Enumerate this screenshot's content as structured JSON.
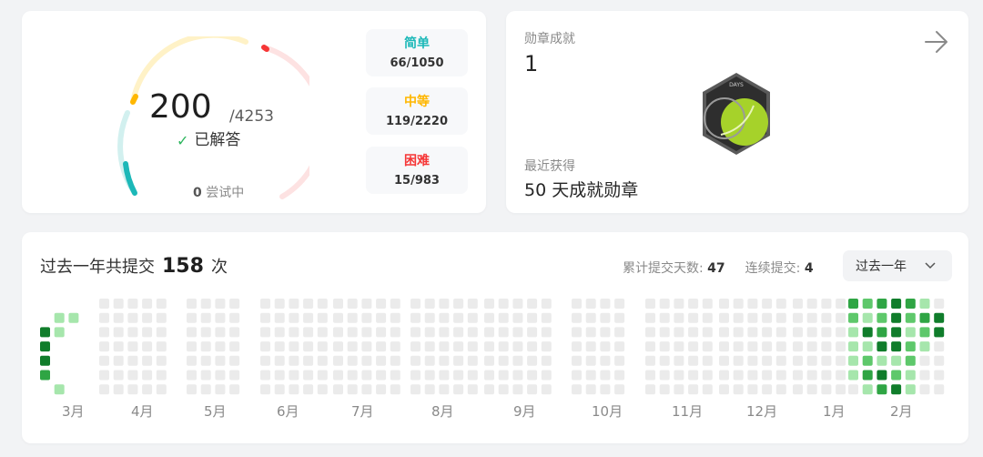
{
  "progress": {
    "solved_count": "200",
    "total": "/4253",
    "solved_label": "已解答",
    "attempting_count": "0",
    "attempting_label": "尝试中"
  },
  "difficulty": [
    {
      "name": "简单",
      "value": "66/1050",
      "color": "#1cb8b8"
    },
    {
      "name": "中等",
      "value": "119/2220",
      "color": "#ffb700"
    },
    {
      "name": "困难",
      "value": "15/983",
      "color": "#f63636"
    }
  ],
  "badges": {
    "title": "勋章成就",
    "count": "1",
    "badge_text": "DAYS",
    "recent_label": "最近获得",
    "recent_name": "50 天成就勋章"
  },
  "heatmap": {
    "title_prefix": "过去一年共提交",
    "total": "158",
    "title_suffix": "次",
    "days_label": "累计提交天数:",
    "days_value": "47",
    "streak_label": "连续提交:",
    "streak_value": "4",
    "range_label": "过去一年",
    "months": [
      "3月",
      "4月",
      "5月",
      "6月",
      "7月",
      "8月",
      "9月",
      "10月",
      "11月",
      "12月",
      "1月",
      "2月"
    ],
    "colors": {
      "empty": "#ebebeb",
      "level1": "#a6e6ac",
      "level2": "#5ec86b",
      "level3": "#2fa544",
      "level4": "#107d2b"
    }
  }
}
